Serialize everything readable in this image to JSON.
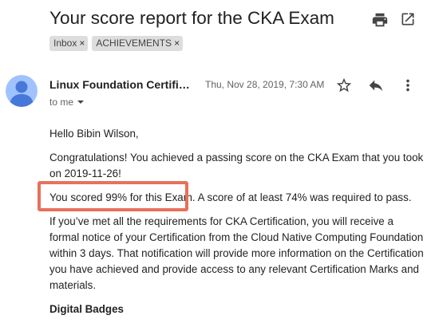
{
  "email": {
    "subject": "Your score report for the CKA Exam",
    "labels": [
      {
        "text": "Inbox",
        "remove": "×"
      },
      {
        "text": "ACHIEVEMENTS",
        "remove": "×"
      }
    ],
    "sender": "Linux Foundation Certification",
    "date": "Thu, Nov 28, 2019, 7:30 AM",
    "recipient": "to me",
    "body": {
      "greeting": "Hello Bibin Wilson,",
      "congrats": "Congratulations!  You achieved a passing score on the CKA Exam that you took on 2019-11-26!",
      "score": "You scored 99% for this Exam. A score of at least 74% was required to pass.",
      "requirements": "If you’ve met all the requirements for CKA Certification, you will receive a formal notice of your Certification from the Cloud Native Computing Foundation within 3 days. That notification will provide more information on the Certification you have achieved and provide access to any relevant Certification Marks and materials.",
      "heading": "Digital Badges"
    }
  },
  "icons": {
    "print": "print-icon",
    "open": "open-in-new-window-icon",
    "star": "star-icon",
    "reply": "reply-icon",
    "more": "more-vertical-icon",
    "dropdown": "chevron-down-icon"
  },
  "colors": {
    "highlight_border": "#e8705a",
    "avatar_bg": "#a0c3ff",
    "label_bg": "#dddddd"
  }
}
